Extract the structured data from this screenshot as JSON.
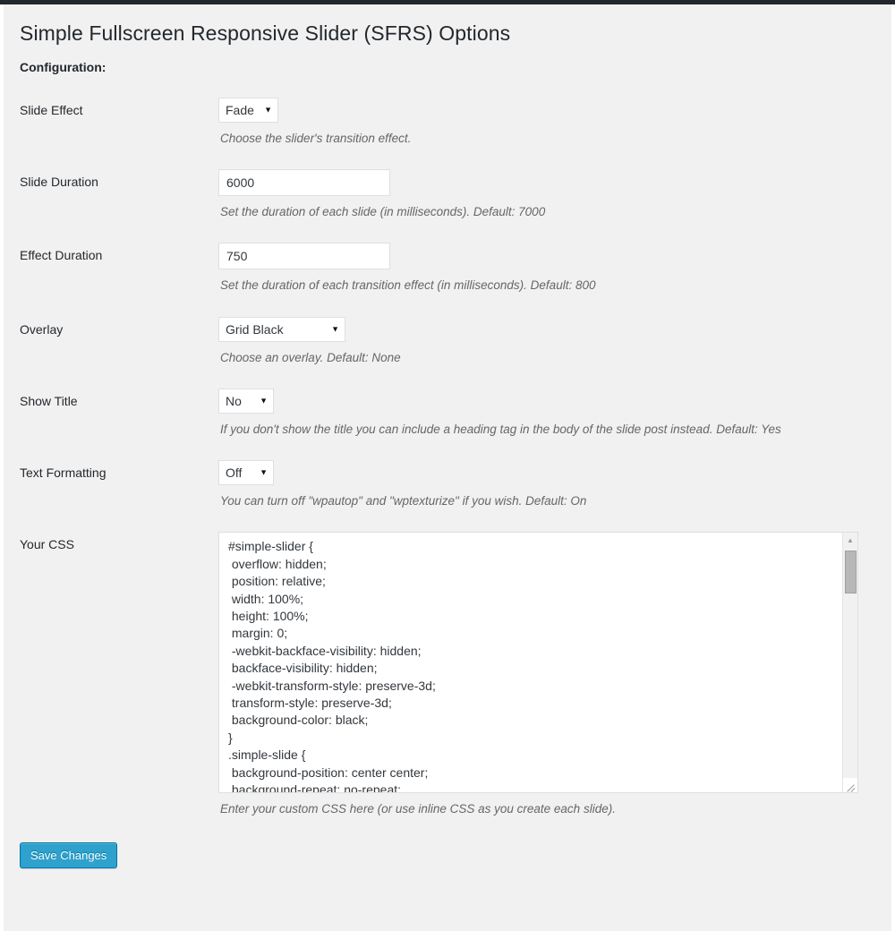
{
  "page": {
    "title": "Simple Fullscreen Responsive Slider (SFRS) Options",
    "config_heading": "Configuration:"
  },
  "fields": {
    "slide_effect": {
      "label": "Slide Effect",
      "value": "Fade",
      "arrow": "▼",
      "description": "Choose the slider's transition effect."
    },
    "slide_duration": {
      "label": "Slide Duration",
      "value": "6000",
      "description": "Set the duration of each slide (in milliseconds). Default: 7000"
    },
    "effect_duration": {
      "label": "Effect Duration",
      "value": "750",
      "description": "Set the duration of each transition effect (in milliseconds). Default: 800"
    },
    "overlay": {
      "label": "Overlay",
      "value": "Grid Black",
      "arrow": "▼",
      "description": "Choose an overlay. Default: None"
    },
    "show_title": {
      "label": "Show Title",
      "value": "No",
      "arrow": "▼",
      "description": "If you don't show the title you can include a heading tag in the body of the slide post instead. Default: Yes"
    },
    "text_formatting": {
      "label": "Text Formatting",
      "value": "Off",
      "arrow": "▼",
      "description": "You can turn off \"wpautop\" and \"wptexturize\" if you wish. Default: On"
    },
    "your_css": {
      "label": "Your CSS",
      "value": "#simple-slider {\n overflow: hidden;\n position: relative;\n width: 100%;\n height: 100%;\n margin: 0;\n -webkit-backface-visibility: hidden;\n backface-visibility: hidden;\n -webkit-transform-style: preserve-3d;\n transform-style: preserve-3d;\n background-color: black;\n}\n.simple-slide {\n background-position: center center;\n background-repeat: no-repeat;",
      "description": "Enter your custom CSS here (or use inline CSS as you create each slide).",
      "scroll_up_arrow": "▲",
      "scroll_down_arrow": "▼"
    }
  },
  "submit": {
    "save_label": "Save Changes"
  },
  "colors": {
    "primary_button": "#2ea2cc",
    "primary_button_border": "#0074a2",
    "page_background": "#f1f1f1",
    "admin_bar": "#23282d"
  }
}
